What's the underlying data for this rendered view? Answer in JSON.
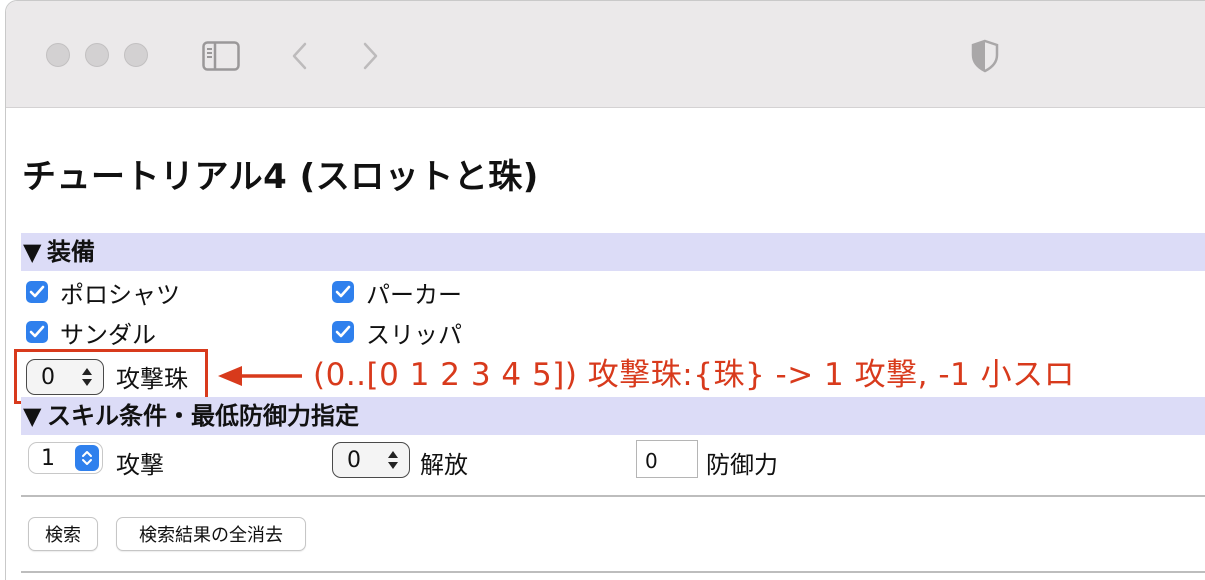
{
  "browser": {
    "toolbar_icons": [
      "sidebar-icon",
      "back-icon",
      "forward-icon",
      "shield-icon"
    ]
  },
  "page": {
    "title": "チュートリアル4 (スロットと珠)"
  },
  "equipment_section": {
    "header": "装備",
    "items": [
      {
        "label": "ポロシャツ",
        "checked": true
      },
      {
        "label": "パーカー",
        "checked": true
      },
      {
        "label": "サンダル",
        "checked": true
      },
      {
        "label": "スリッパ",
        "checked": true
      }
    ],
    "jewel_select": {
      "value": "0",
      "label": "攻撃珠"
    }
  },
  "annotation": {
    "text": "(0..[0 1 2 3 4 5]) 攻撃珠:{珠} -> 1 攻撃, -1 小スロ",
    "color": "#d83a1c"
  },
  "skill_section": {
    "header": "スキル条件・最低防御力指定",
    "attack_select": {
      "value": "1",
      "label": "攻撃"
    },
    "release_select": {
      "value": "0",
      "label": "解放"
    },
    "defense_input": {
      "value": "0",
      "label": "防御力"
    }
  },
  "buttons": {
    "search": "検索",
    "clear_all": "検索結果の全消去"
  },
  "colors": {
    "section_bg": "#dcdcf7",
    "checkbox": "#2f80ed",
    "annotation": "#d83a1c"
  }
}
